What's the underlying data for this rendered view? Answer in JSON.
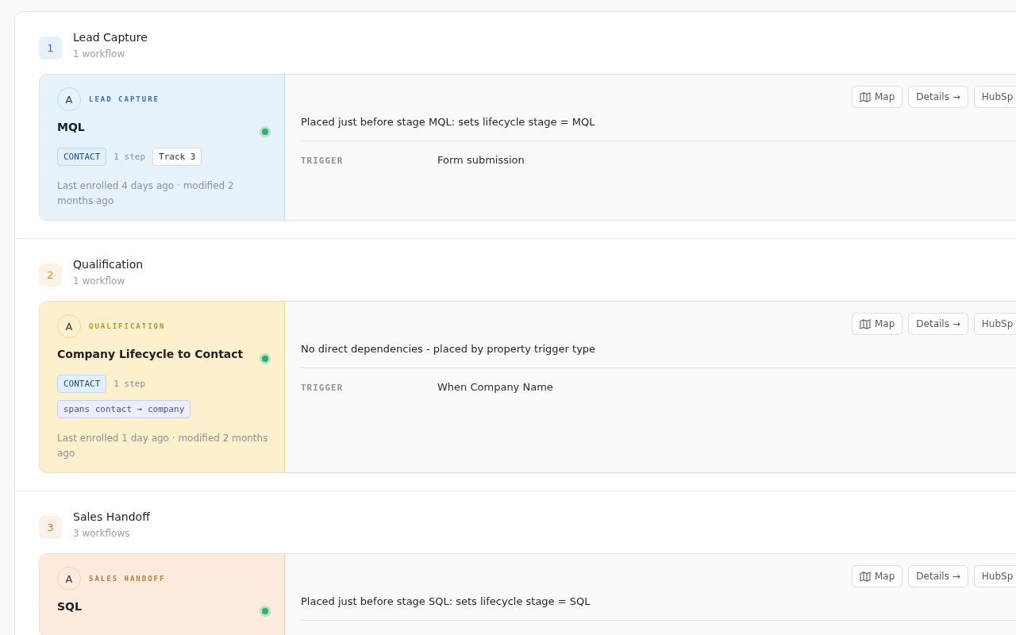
{
  "sections": [
    {
      "number": "1",
      "title": "Lead Capture",
      "count": "1 workflow",
      "color": "#2f6fd0",
      "workflows": [
        {
          "avatar": "A",
          "stage": "LEAD CAPTURE",
          "name": "MQL",
          "active": true,
          "chips": [
            {
              "kind": "object",
              "text": "CONTACT"
            },
            {
              "kind": "steps",
              "text": "1 step"
            },
            {
              "kind": "track",
              "text": "Track 3"
            }
          ],
          "meta": "Last enrolled 4 days ago · modified 2 months ago",
          "actions": [
            {
              "kind": "map",
              "label": "Map"
            },
            {
              "kind": "details",
              "label": "Details →"
            },
            {
              "kind": "external",
              "label": "HubSp"
            }
          ],
          "description": "Placed just before stage MQL: sets lifecycle stage = MQL",
          "fields": [
            {
              "label": "TRIGGER",
              "value": "Form submission"
            }
          ]
        }
      ]
    },
    {
      "number": "2",
      "title": "Qualification",
      "count": "1 workflow",
      "color": "#c8922a",
      "workflows": [
        {
          "avatar": "A",
          "stage": "QUALIFICATION",
          "name": "Company Lifecycle to Contact",
          "active": true,
          "chips": [
            {
              "kind": "object",
              "text": "CONTACT"
            },
            {
              "kind": "steps",
              "text": "1 step"
            }
          ],
          "extra_chips": [
            {
              "kind": "spans",
              "text": "spans contact → company"
            }
          ],
          "meta": "Last enrolled 1 day ago · modified 2 months ago",
          "actions": [
            {
              "kind": "map",
              "label": "Map"
            },
            {
              "kind": "details",
              "label": "Details →"
            },
            {
              "kind": "external",
              "label": "HubSp"
            }
          ],
          "description": "No direct dependencies - placed by property trigger type",
          "fields": [
            {
              "label": "TRIGGER",
              "value": "When Company Name"
            }
          ]
        }
      ]
    },
    {
      "number": "3",
      "title": "Sales Handoff",
      "count": "3 workflows",
      "color": "#c07a3a",
      "workflows": [
        {
          "avatar": "A",
          "stage": "SALES HANDOFF",
          "name": "SQL",
          "active": true,
          "actions": [
            {
              "kind": "map",
              "label": "Map"
            },
            {
              "kind": "details",
              "label": "Details →"
            },
            {
              "kind": "external",
              "label": "HubSp"
            }
          ],
          "description": "Placed just before stage SQL: sets lifecycle stage = SQL"
        }
      ]
    }
  ]
}
